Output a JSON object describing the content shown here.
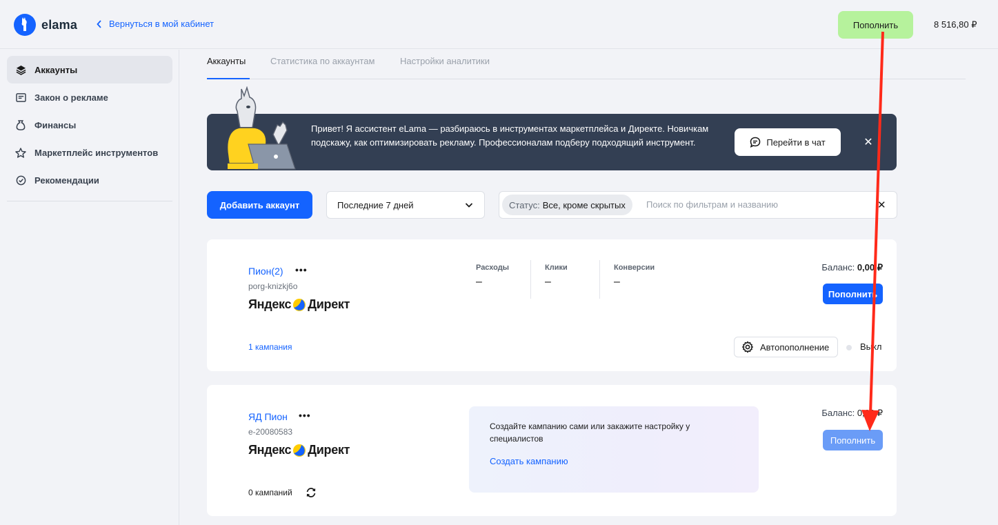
{
  "header": {
    "logo_text": "elama",
    "back_link": "Вернуться в мой кабинет",
    "refill_label": "Пополнить",
    "balance": "8 516,80 ₽"
  },
  "sidebar": {
    "items": [
      {
        "label": "Аккаунты",
        "icon": "layers-icon",
        "active": true
      },
      {
        "label": "Закон о рекламе",
        "icon": "document-icon",
        "active": false
      },
      {
        "label": "Финансы",
        "icon": "money-bag-icon",
        "active": false
      },
      {
        "label": "Маркетплейс инструментов",
        "icon": "star-icon",
        "active": false
      },
      {
        "label": "Рекомендации",
        "icon": "check-circle-icon",
        "active": false
      }
    ]
  },
  "tabs": [
    {
      "label": "Аккаунты",
      "active": true
    },
    {
      "label": "Статистика по аккаунтам",
      "active": false
    },
    {
      "label": "Настройки аналитики",
      "active": false
    }
  ],
  "banner": {
    "text": "Привет! Я ассистент eLama — разбираюсь в инструментах маркетплейса и Директе. Новичкам подскажу, как оптимизировать рекламу. Профессионалам подберу подходящий инструмент.",
    "chat_button": "Перейти в чат",
    "close": "✕"
  },
  "controls": {
    "add_account": "Добавить аккаунт",
    "period": "Последние 7 дней",
    "status_label": "Статус:",
    "status_value": "Все, кроме скрытых",
    "search_placeholder": "Поиск по фильтрам и названию",
    "clear": "✕"
  },
  "accounts": [
    {
      "name": "Пион(2)",
      "login": "porg-knizkj6o",
      "platform_left": "Яндекс",
      "platform_right": "Директ",
      "metrics": [
        {
          "label": "Расходы",
          "value": "–"
        },
        {
          "label": "Клики",
          "value": "–"
        },
        {
          "label": "Конверсии",
          "value": "–"
        }
      ],
      "balance_label": "Баланс:",
      "balance_value": "0,00 ₽",
      "refill": "Пополнить",
      "campaigns": "1 кампания",
      "autorefill": "Автопополнение",
      "autorefill_state": "Выкл"
    },
    {
      "name": "ЯД Пион",
      "login": "e-20080583",
      "platform_left": "Яндекс",
      "platform_right": "Директ",
      "promo_text": "Создайте кампанию сами или закажите настройку у специалистов",
      "promo_link": "Создать кампанию",
      "balance_label": "Баланс:",
      "balance_value": "0,00 ₽",
      "refill": "Пополнить",
      "campaigns": "0 кампаний"
    }
  ],
  "colors": {
    "accent": "#1463ff",
    "top_refill_bg": "#b6f29c",
    "banner_bg": "#333f53",
    "annotation_arrow": "#ff2a1a"
  }
}
